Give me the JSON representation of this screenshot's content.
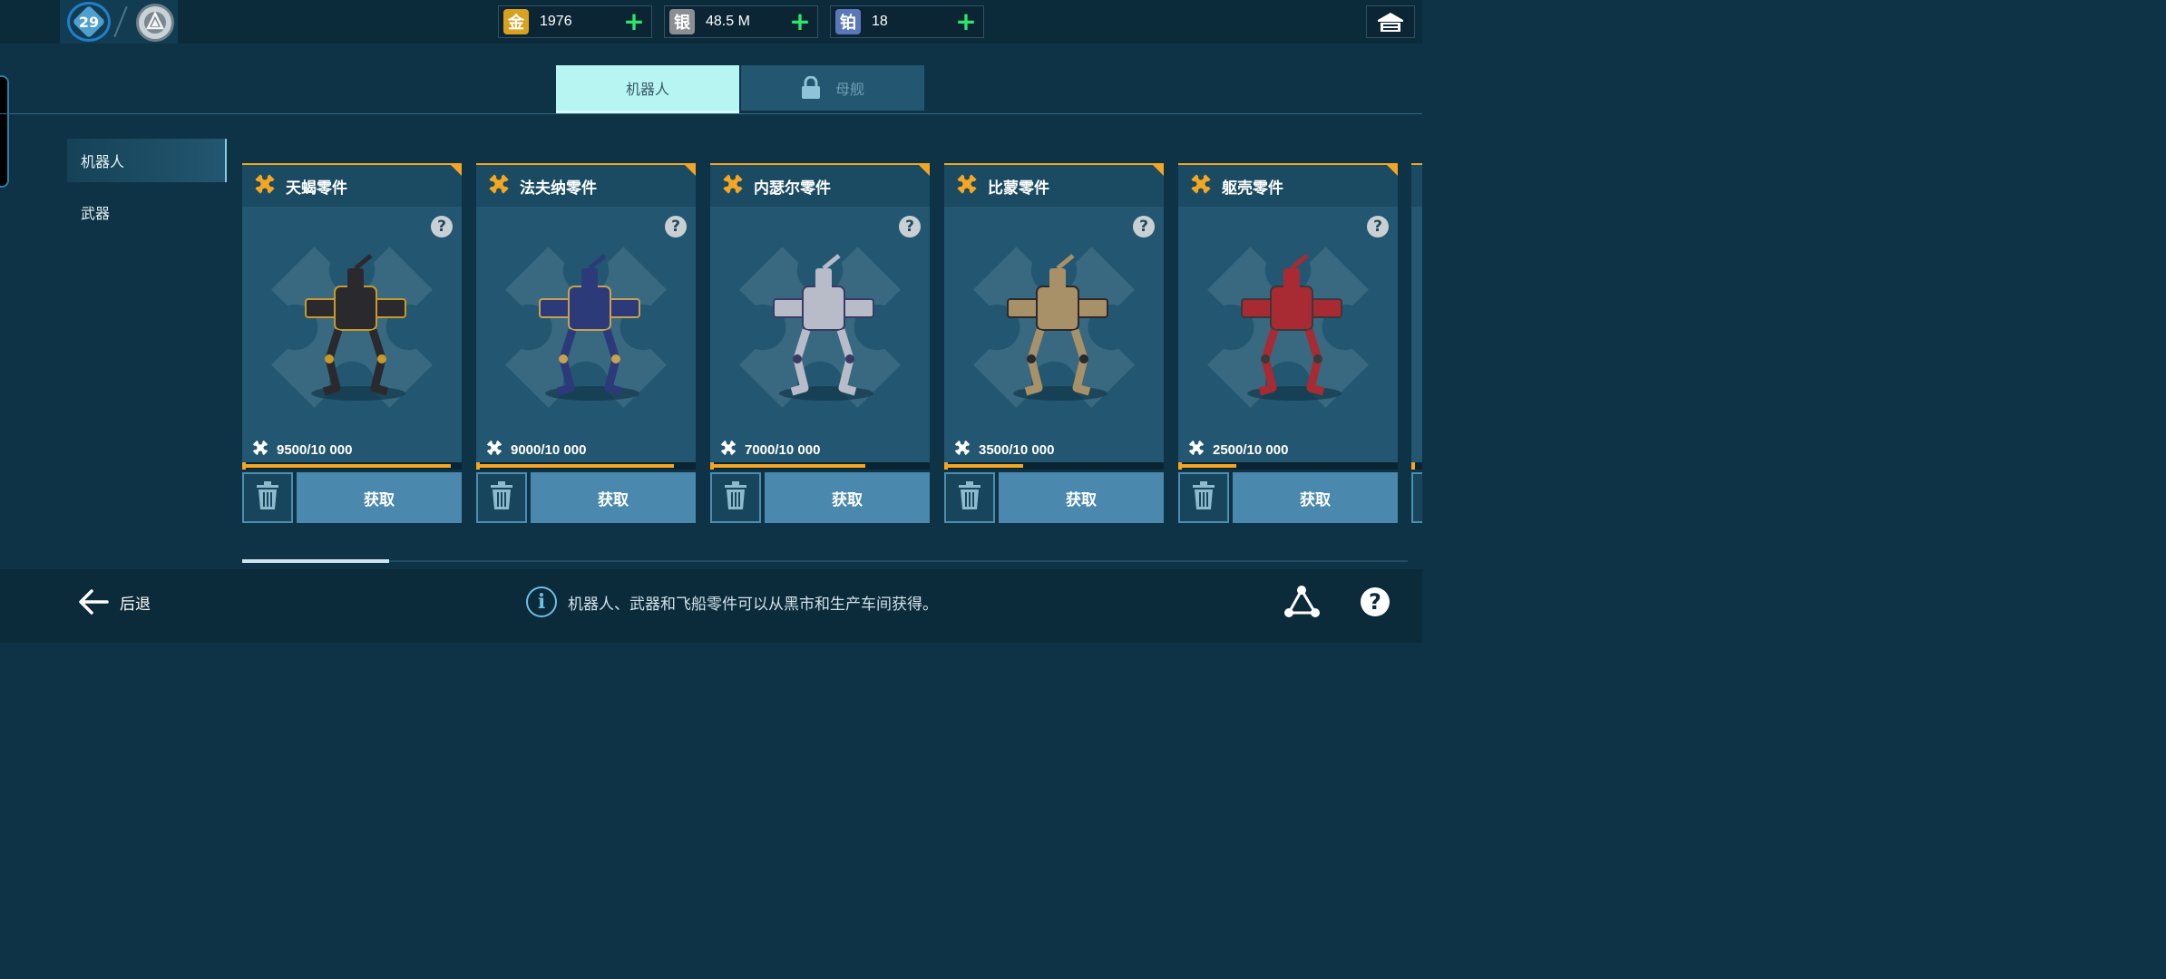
{
  "profile": {
    "level": "29"
  },
  "currencies": [
    {
      "glyph": "金",
      "value": "1976",
      "color": "#d8a21e"
    },
    {
      "glyph": "银",
      "value": "48.5 M",
      "color": "#8b8f93"
    },
    {
      "glyph": "铂",
      "value": "18",
      "color": "#5a78b8"
    }
  ],
  "tabs": {
    "robots": "机器人",
    "mothership": "母舰"
  },
  "sidebar": {
    "items": [
      {
        "label": "机器人"
      },
      {
        "label": "武器"
      }
    ]
  },
  "cards": [
    {
      "title": "天蝎零件",
      "progress_text": "9500/10 000",
      "progress": 0.95,
      "action": "获取",
      "robot_color": "#2a2a2e",
      "accent": "#c89a2a"
    },
    {
      "title": "法夫纳零件",
      "progress_text": "9000/10 000",
      "progress": 0.9,
      "action": "获取",
      "robot_color": "#2c3a7a",
      "accent": "#c8a050"
    },
    {
      "title": "内瑟尔零件",
      "progress_text": "7000/10 000",
      "progress": 0.7,
      "action": "获取",
      "robot_color": "#b8bcc8",
      "accent": "#3a3a66"
    },
    {
      "title": "比蒙零件",
      "progress_text": "3500/10 000",
      "progress": 0.35,
      "action": "获取",
      "robot_color": "#a89068",
      "accent": "#2a2a2a"
    },
    {
      "title": "躯壳零件",
      "progress_text": "2500/10 000",
      "progress": 0.25,
      "action": "获取",
      "robot_color": "#a82a32",
      "accent": "#3a3a3a"
    }
  ],
  "bottom": {
    "back_label": "后退",
    "info_text": "机器人、武器和飞船零件可以从黑市和生产车间获得。"
  },
  "colors": {
    "accent_orange": "#f4a623",
    "plus_green": "#2ee86a",
    "get_button": "#4a88ad"
  }
}
